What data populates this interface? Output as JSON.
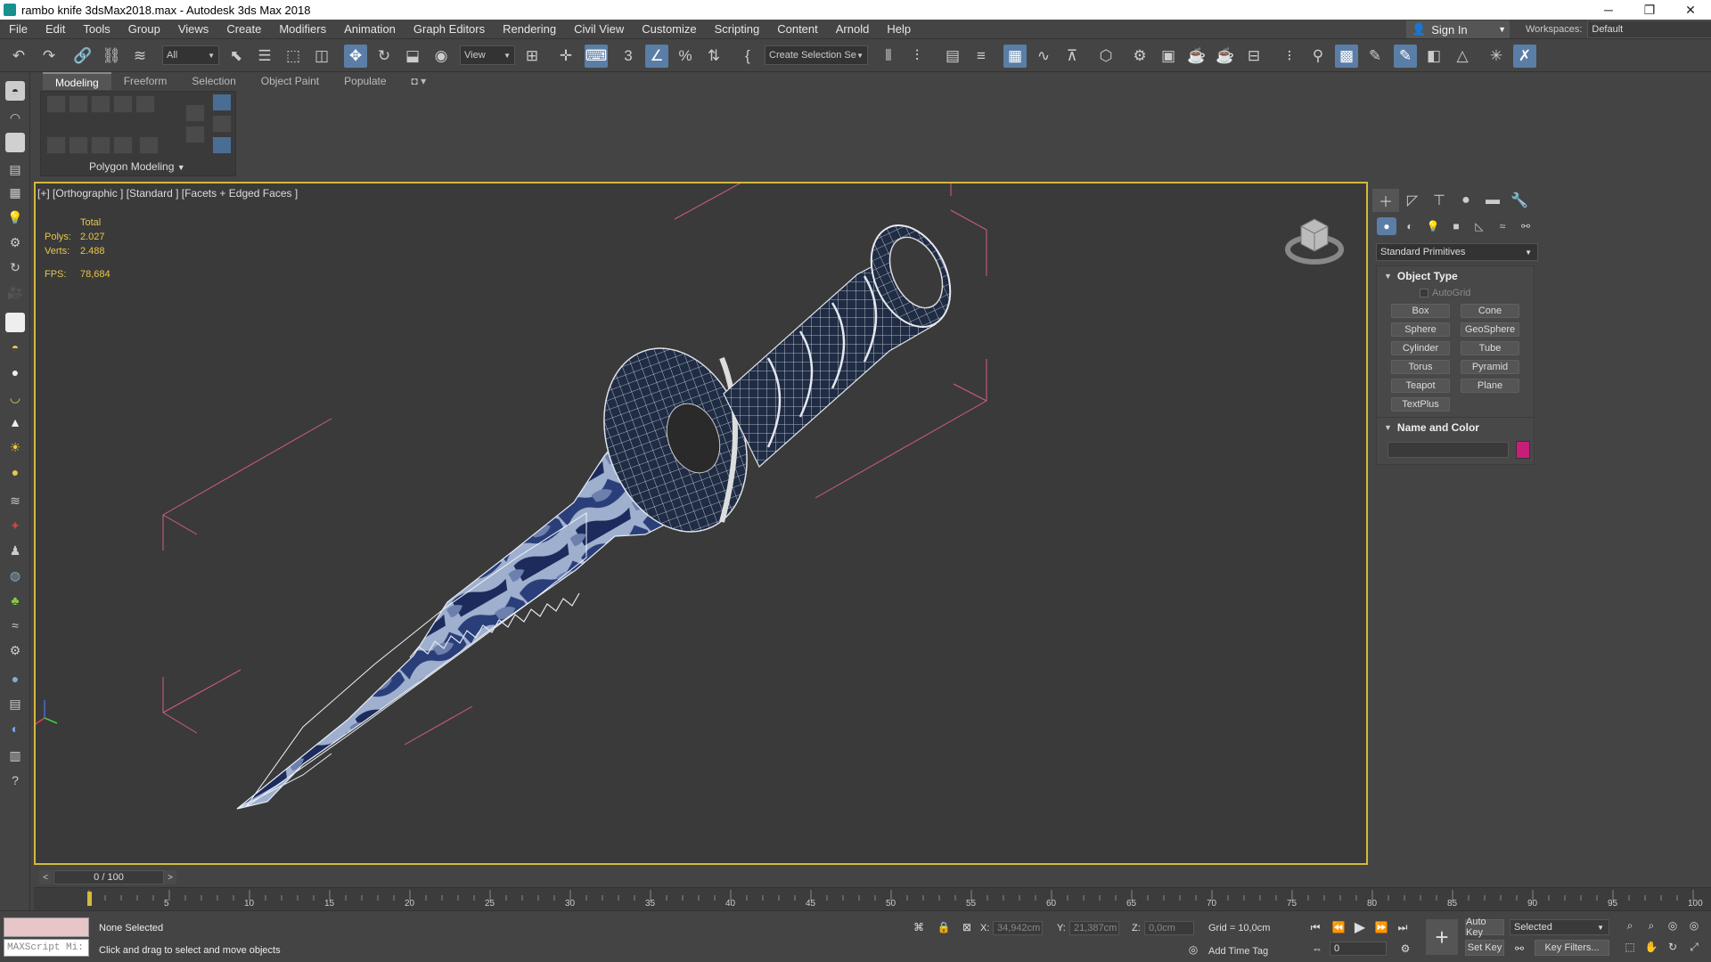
{
  "window": {
    "title": "rambo knife 3dsMax2018.max - Autodesk 3ds Max 2018",
    "minimize": "─",
    "restore": "❐",
    "close": "✕"
  },
  "menu": [
    "File",
    "Edit",
    "Tools",
    "Group",
    "Views",
    "Create",
    "Modifiers",
    "Animation",
    "Graph Editors",
    "Rendering",
    "Civil View",
    "Customize",
    "Scripting",
    "Content",
    "Arnold",
    "Help"
  ],
  "account": {
    "sign_in": "Sign In",
    "workspaces_label": "Workspaces:",
    "workspace": "Default"
  },
  "toolbar": {
    "selection_filter": "All",
    "ref_coord": "View",
    "named_selection": "Create Selection Se"
  },
  "ribbon": {
    "tabs": [
      "Modeling",
      "Freeform",
      "Selection",
      "Object Paint",
      "Populate"
    ],
    "active_tab": "Modeling",
    "panel_label": "Polygon Modeling"
  },
  "viewport": {
    "label": "[+] [Orthographic ] [Standard ] [Facets + Edged Faces ]",
    "stats": {
      "header": "Total",
      "polys_label": "Polys:",
      "polys": "2.027",
      "verts_label": "Verts:",
      "verts": "2.488",
      "fps_label": "FPS:",
      "fps": "78,684"
    }
  },
  "command_panel": {
    "category": "Standard Primitives",
    "object_type_title": "Object Type",
    "autogrid": "AutoGrid",
    "primitives": [
      "Box",
      "Cone",
      "Sphere",
      "GeoSphere",
      "Cylinder",
      "Tube",
      "Torus",
      "Pyramid",
      "Teapot",
      "Plane",
      "TextPlus"
    ],
    "name_color_title": "Name and Color",
    "object_color": "#c81e7a"
  },
  "timeline": {
    "frame": "0 / 100",
    "ticks": [
      "5",
      "10",
      "15",
      "20",
      "25",
      "30",
      "35",
      "40",
      "45",
      "50",
      "55",
      "60",
      "65",
      "70",
      "75",
      "80",
      "85",
      "90",
      "95",
      "100"
    ]
  },
  "status": {
    "maxscript": "MAXScript Mi:",
    "selection": "None Selected",
    "prompt": "Click and drag to select and move objects",
    "x_label": "X:",
    "x": "34,942cm",
    "y_label": "Y:",
    "y": "21,387cm",
    "z_label": "Z:",
    "z": "0,0cm",
    "grid": "Grid = 10,0cm",
    "add_time_tag": "Add Time Tag",
    "auto_key": "Auto Key",
    "set_key": "Set Key",
    "key_mode": "Selected",
    "key_filters": "Key Filters...",
    "current_frame": "0"
  }
}
